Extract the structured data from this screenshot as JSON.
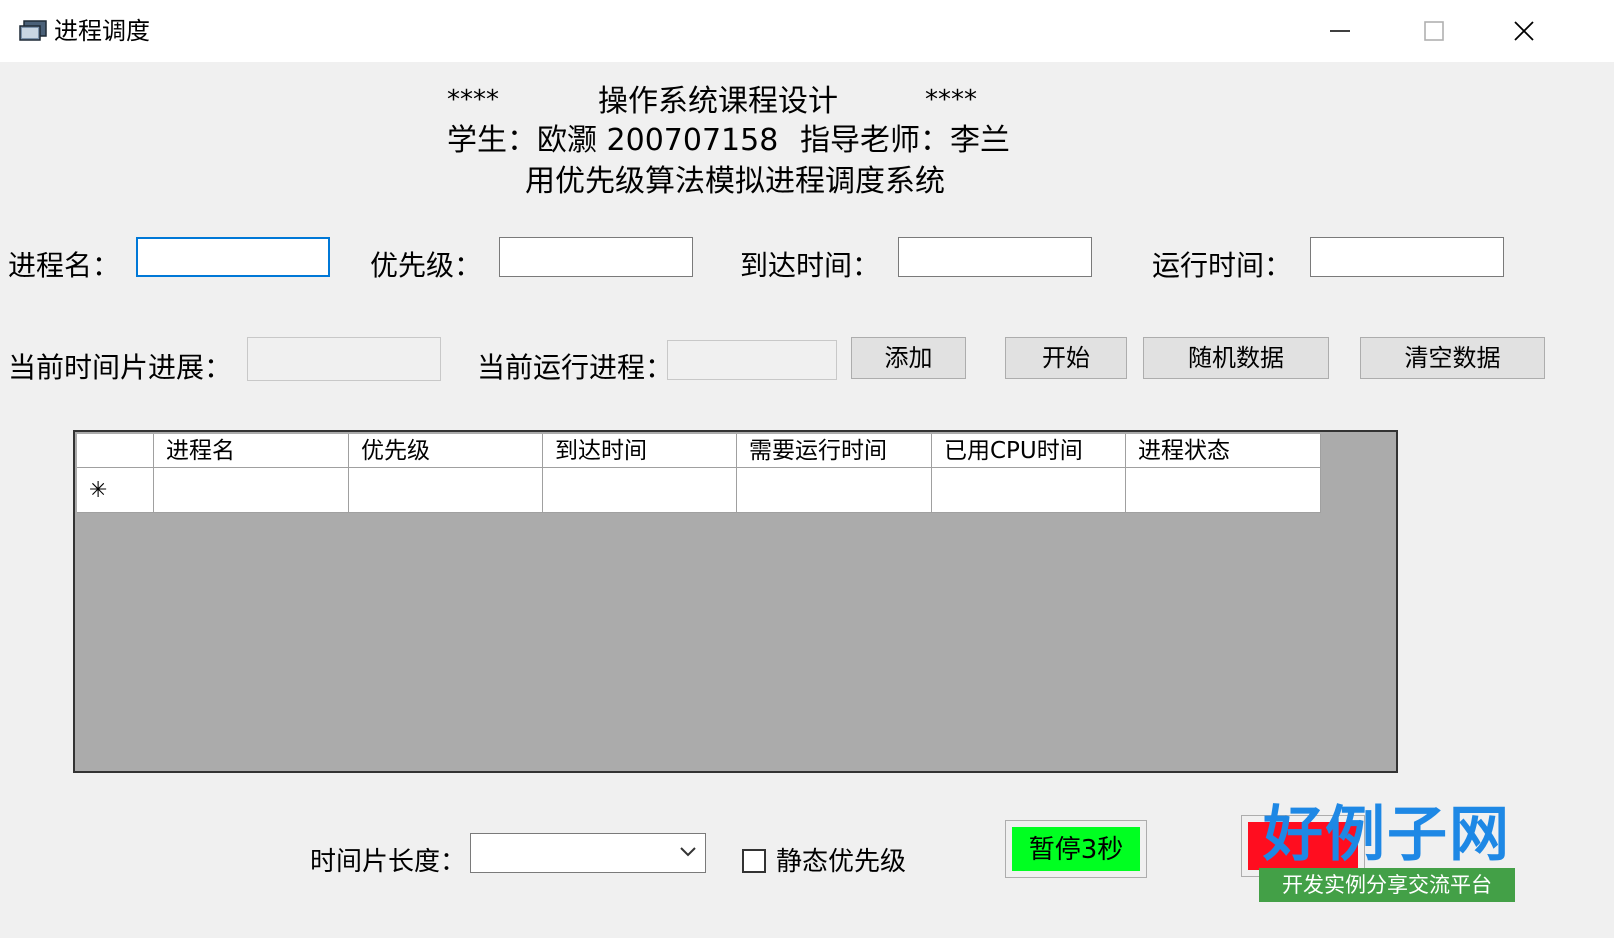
{
  "window": {
    "title": "进程调度",
    "icon": "app-window-icon",
    "controls": [
      "minimize-icon",
      "maximize-icon",
      "close-icon"
    ]
  },
  "header": {
    "stars_left": "****",
    "course": "操作系统课程设计",
    "stars_right": "****",
    "student_line": "学生：欧灏 200707158",
    "teacher_line": "指导老师：李兰",
    "subtitle": "用优先级算法模拟进程调度系统"
  },
  "form": {
    "process_name_label": "进程名：",
    "priority_label": "优先级：",
    "arrival_label": "到达时间：",
    "runtime_label": "运行时间：",
    "process_name_value": "",
    "priority_value": "",
    "arrival_value": "",
    "runtime_value": "",
    "slice_progress_label": "当前时间片进展：",
    "current_process_label": "当前运行进程：",
    "slice_progress_value": "",
    "current_process_value": ""
  },
  "buttons": {
    "add": "添加",
    "start": "开始",
    "random": "随机数据",
    "clear": "清空数据"
  },
  "grid": {
    "columns": [
      "进程名",
      "优先级",
      "到达时间",
      "需要运行时间",
      "已用CPU时间",
      "进程状态"
    ],
    "new_row_marker": "✳",
    "rows": []
  },
  "bottom": {
    "slice_length_label": "时间片长度：",
    "slice_length_value": "",
    "static_priority_label": "静态优先级",
    "static_priority_checked": false,
    "pause_button": "暂停3秒",
    "pause_color": "#00ff21",
    "red_button_color": "#ff0d1f"
  },
  "watermark": {
    "brand": "好例子网",
    "tagline": "开发实例分享交流平台"
  }
}
